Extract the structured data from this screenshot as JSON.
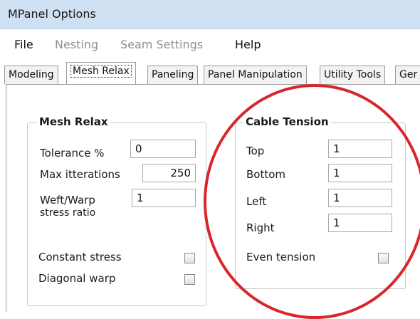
{
  "window": {
    "title": "MPanel Options"
  },
  "menu": [
    {
      "label": "File",
      "disabled": false
    },
    {
      "label": "Nesting",
      "disabled": true
    },
    {
      "label": "Seam Settings",
      "disabled": true
    },
    {
      "label": "Help",
      "disabled": false
    }
  ],
  "tabs": [
    "Modeling",
    "Mesh Relax",
    "Paneling",
    "Panel Manipulation",
    "Utility Tools",
    "Ger"
  ],
  "active_tab": "Mesh Relax",
  "mesh_relax": {
    "title": "Mesh Relax",
    "tolerance_label": "Tolerance %",
    "tolerance_value": "0",
    "max_iterations_label": "Max itterations",
    "max_iterations_value": "250",
    "weft_warp_label_1": "Weft/Warp",
    "weft_warp_label_2": "stress ratio",
    "weft_warp_value": "1",
    "constant_stress_label": "Constant stress",
    "constant_stress_checked": false,
    "diagonal_warp_label": "Diagonal warp",
    "diagonal_warp_checked": false
  },
  "cable_tension": {
    "title": "Cable Tension",
    "top_label": "Top",
    "top_value": "1",
    "bottom_label": "Bottom",
    "bottom_value": "1",
    "left_label": "Left",
    "left_value": "1",
    "right_label": "Right",
    "right_value": "1",
    "even_tension_label": "Even tension",
    "even_tension_checked": false
  },
  "colors": {
    "annotation_circle": "#d9262b",
    "titlebar": "#cfe0f3"
  }
}
